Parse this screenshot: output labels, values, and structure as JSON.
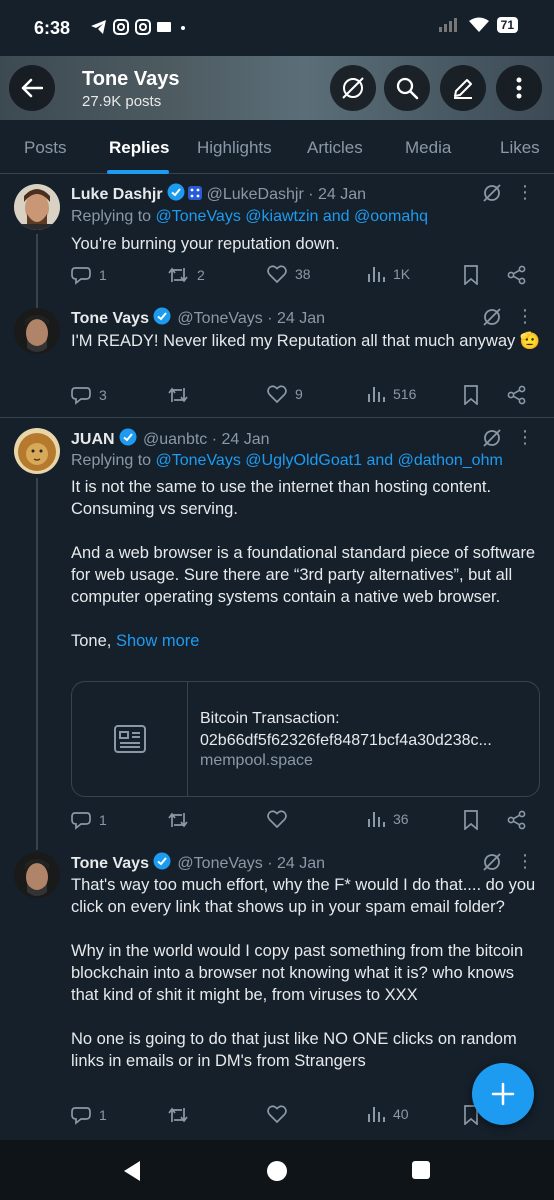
{
  "status_bar": {
    "time": "6:38",
    "battery": "71"
  },
  "header": {
    "name": "Tone Vays",
    "posts": "27.9K posts"
  },
  "tabs": [
    "Posts",
    "Replies",
    "Highlights",
    "Articles",
    "Media",
    "Likes"
  ],
  "active_tab": "Replies",
  "tweets": [
    {
      "name": "Luke Dashjr",
      "handle": "@LukeDashjr",
      "date": "· 24 Jan",
      "replying_prefix": "Replying to ",
      "replying_to": "@ToneVays @kiawtzin and @oomahq",
      "text": "You're burning your reputation down.",
      "replies": "1",
      "reposts": "2",
      "likes": "38",
      "views": "1K"
    },
    {
      "name": "Tone Vays",
      "handle": "@ToneVays",
      "date": "· 24 Jan",
      "text": "I'M READY! Never liked my Reputation all that much anyway 🫡",
      "replies": "3",
      "reposts": "",
      "likes": "9",
      "views": "516"
    },
    {
      "name": "JUAN",
      "handle": "@uanbtc",
      "date": "· 24 Jan",
      "replying_prefix": "Replying to ",
      "replying_to": "@ToneVays @UglyOldGoat1 and @dathon_ohm",
      "paragraphs": [
        "It is not the same to use the internet than hosting content. Consuming vs serving.",
        "And a web browser is a foundational standard piece of software for web usage. Sure there are “3rd party alternatives”, but all computer operating systems contain a native web browser.",
        "Tone,"
      ],
      "show_more": "Show more",
      "card": {
        "title": "Bitcoin Transaction:",
        "title2": "02b66df5f62326fef84871bcf4a30d238c...",
        "domain": "mempool.space"
      },
      "replies": "1",
      "reposts": "",
      "likes": "",
      "views": "36"
    },
    {
      "name": "Tone Vays",
      "handle": "@ToneVays",
      "date": "· 24 Jan",
      "paragraphs": [
        "That's way too much effort, why the F* would I do that.... do you click on every link that shows up in your spam email folder?",
        "Why in the world would I copy past something from the bitcoin blockchain into a browser not knowing what it is? who knows that kind of shit it might be, from viruses to XXX",
        "No one is going to do that just like NO ONE clicks on random links in emails or in DM's from Strangers"
      ],
      "replies": "1",
      "reposts": "",
      "likes": "",
      "views": "40"
    }
  ],
  "colors": {
    "background": "#15202b",
    "accent": "#1d9bf0",
    "muted": "#8b98a5",
    "divider": "#38444d"
  }
}
